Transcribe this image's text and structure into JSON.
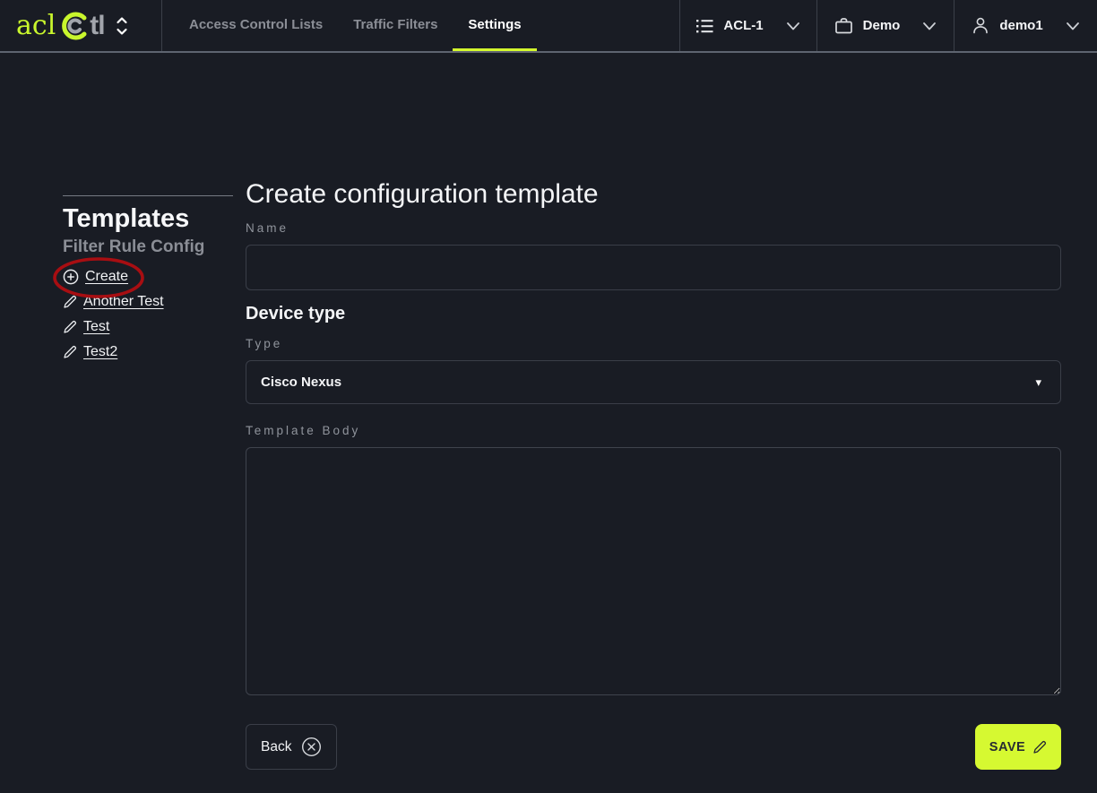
{
  "colors": {
    "accent": "#d6f931",
    "background": "#191c24",
    "annotation_red": "#a80e12",
    "logo_green": "#c9f62d"
  },
  "header": {
    "logo": {
      "part1": "acl",
      "part2": "tl"
    },
    "nav": [
      {
        "label": "Access Control Lists",
        "active": false
      },
      {
        "label": "Traffic Filters",
        "active": false
      },
      {
        "label": "Settings",
        "active": true
      }
    ],
    "acl_selector": {
      "label": "ACL-1",
      "icon": "list-icon"
    },
    "workspace_selector": {
      "label": "Demo",
      "icon": "briefcase-icon"
    },
    "user_menu": {
      "label": "demo1",
      "icon": "person-icon"
    }
  },
  "sidebar": {
    "title": "Templates",
    "subtitle": "Filter Rule Config",
    "create_link": "Create",
    "templates": [
      "Another Test",
      "Test",
      "Test2"
    ]
  },
  "main": {
    "title": "Create configuration template",
    "name_label": "Name",
    "name_value": "",
    "device_type_heading": "Device type",
    "type_label": "Type",
    "type_value": "Cisco Nexus",
    "select_caret": "▾",
    "template_body_label": "Template Body",
    "template_body_value": "",
    "back_label": "Back",
    "save_label": "SAVE"
  },
  "icons": {
    "unfold": "unfold-more chevrons",
    "create": "plus-circle",
    "template_item": "pencil",
    "back": "x-circle",
    "save": "pencil"
  }
}
